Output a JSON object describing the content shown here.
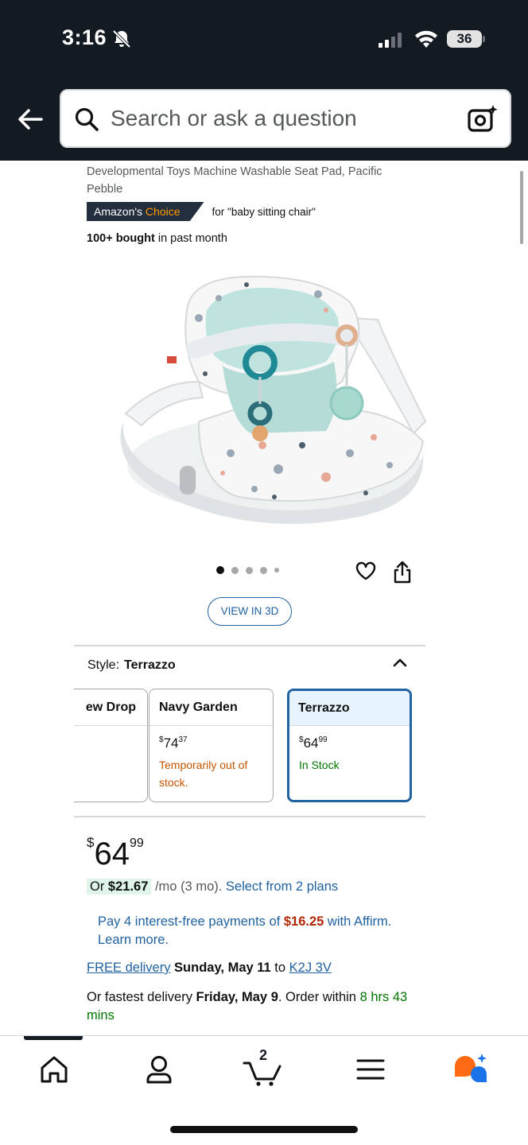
{
  "status_bar": {
    "time": "3:16",
    "battery": "36"
  },
  "search": {
    "placeholder": "Search or ask a question"
  },
  "product": {
    "title": "Developmental Toys Machine Washable Seat Pad, Pacific Pebble",
    "badge_prefix": "Amazon's",
    "badge_suffix": "Choice",
    "badge_for": "for \"baby sitting chair\"",
    "bought_bold": "100+ bought",
    "bought_rest": " in past month",
    "view_3d": "VIEW IN 3D"
  },
  "style": {
    "label": "Style:",
    "selected": "Terrazzo",
    "options": [
      {
        "name": "ew Drop",
        "price_whole": "",
        "price_frac": "",
        "status": ""
      },
      {
        "name": "Navy Garden",
        "price_whole": "74",
        "price_frac": "37",
        "status": "Temporarily out of stock."
      },
      {
        "name": "Terrazzo",
        "price_whole": "64",
        "price_frac": "99",
        "status": "In Stock"
      }
    ]
  },
  "price": {
    "currency": "$",
    "whole": "64",
    "fraction": "99"
  },
  "installments": {
    "or_amount_prefix": "Or ",
    "or_amount": "$21.67",
    "per_month": " /mo (3 mo). ",
    "plans_link": "Select from 2 plans"
  },
  "affirm": {
    "prefix": "Pay 4 interest-free payments of ",
    "amount": "$16.25",
    "suffix": " with Affirm. Learn more."
  },
  "delivery": {
    "free_link": "FREE delivery",
    "date": "Sunday, May 11",
    "to": " to ",
    "location": "K2J 3V",
    "fast_prefix": "Or fastest delivery ",
    "fast_date": "Friday, May 9",
    "order_within": ". Order within ",
    "countdown": "8 hrs 43 mins"
  },
  "bottom_nav": {
    "cart_count": "2",
    "items": [
      "home-icon",
      "account-icon",
      "cart-icon",
      "menu-icon",
      "rufus-icon"
    ]
  },
  "colors": {
    "header_bg": "#131a22",
    "link": "#2162a1",
    "in_stock": "#007600",
    "out_of_stock": "#c45500",
    "deal_red": "#b12704",
    "badge_orange": "#ff9900"
  }
}
